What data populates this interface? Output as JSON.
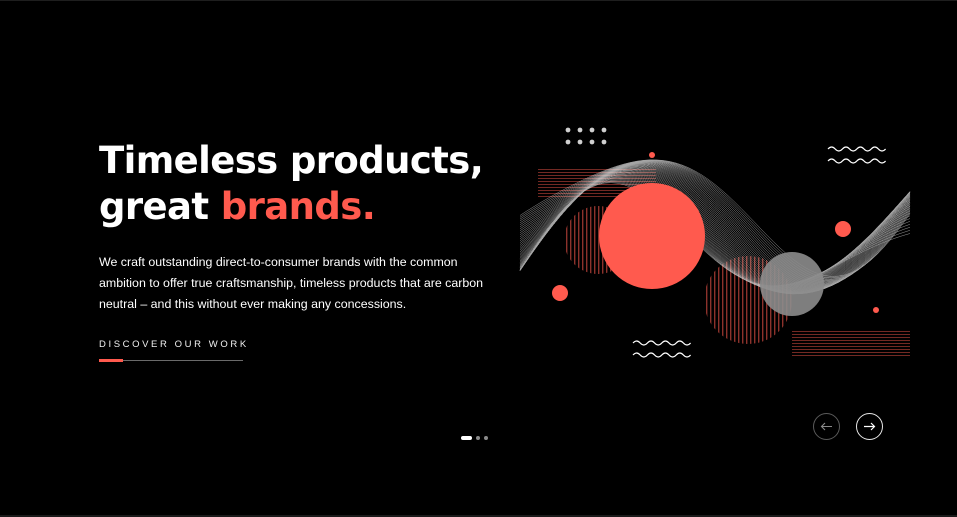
{
  "hero": {
    "title_line1": "Timeless products,",
    "title_line2_prefix": "great ",
    "title_accent": "brands.",
    "description": "We craft outstanding direct-to-consumer brands with the common ambition to offer true craftsmanship, timeless products that are carbon neutral – and this without ever making any concessions.",
    "cta_label": "DISCOVER OUR WORK",
    "cta_progress": 0.17
  },
  "slider": {
    "slide_count": 3,
    "active_slide": 1,
    "prev_icon": "arrow-left-icon",
    "next_icon": "arrow-right-icon"
  },
  "colors": {
    "background": "#000000",
    "accent": "#ff5a4e",
    "text": "#ffffff"
  }
}
